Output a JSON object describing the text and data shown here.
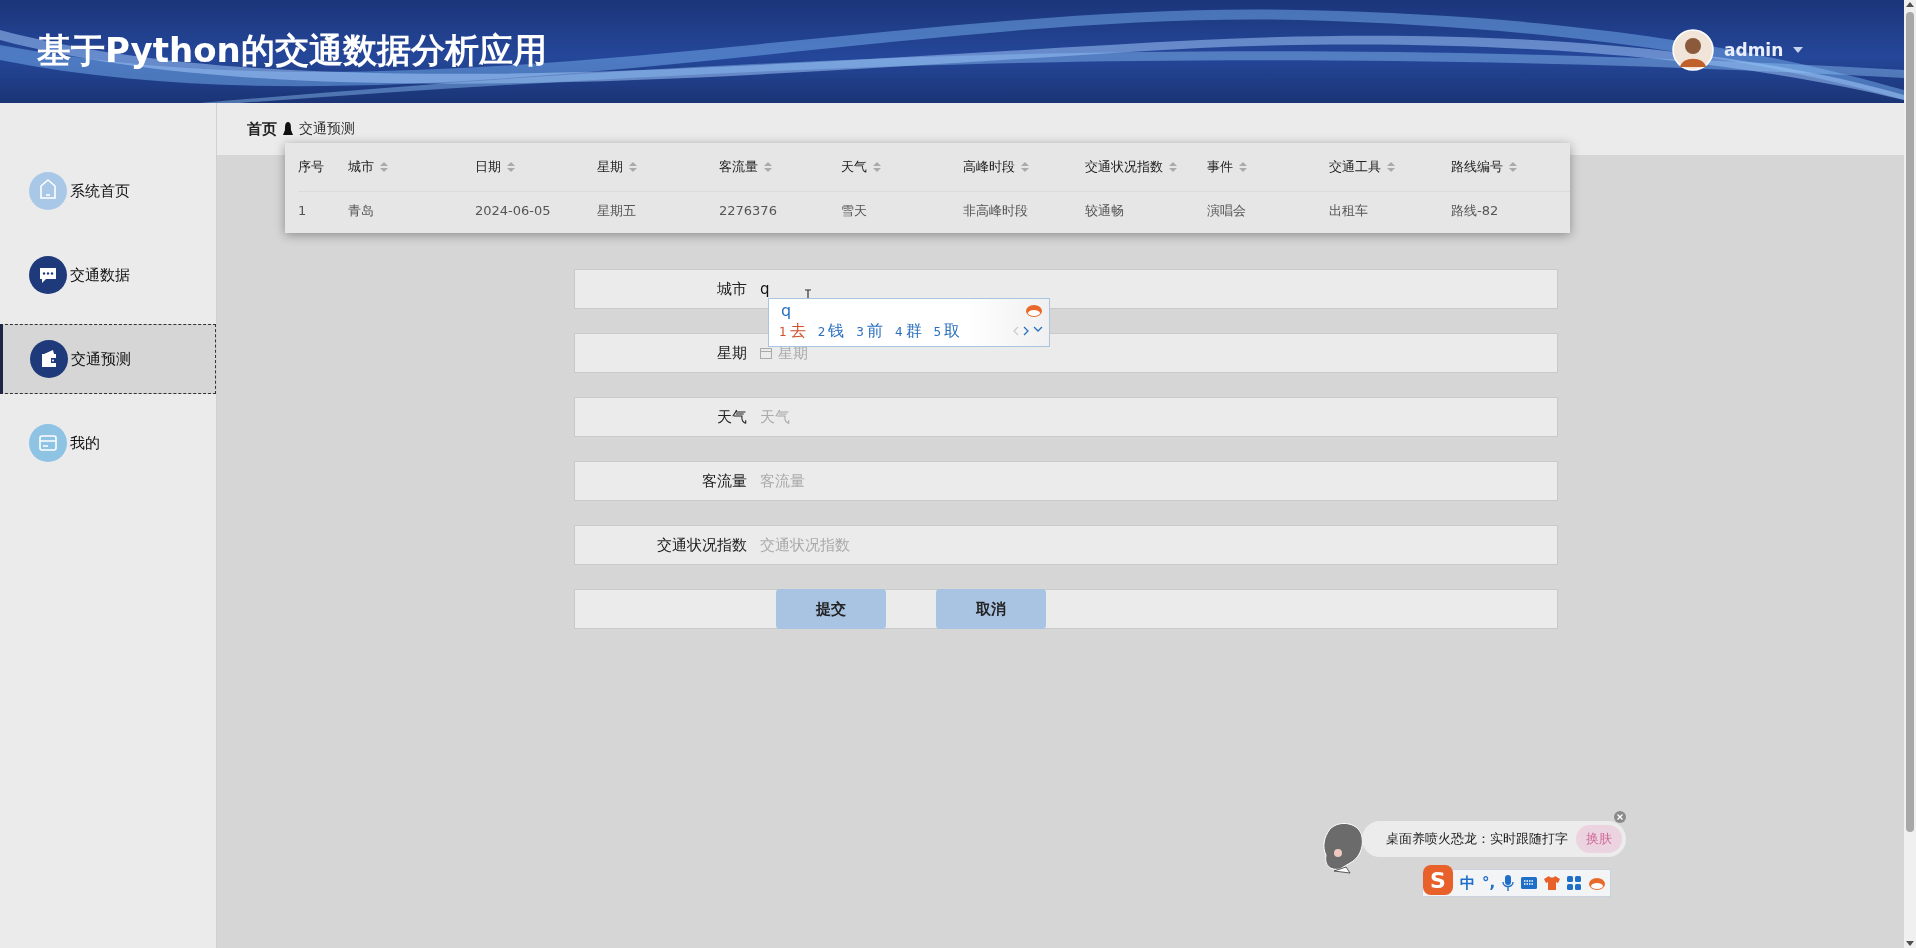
{
  "header": {
    "title": "基于Python的交通数据分析应用",
    "user": "admin"
  },
  "sidebar": {
    "items": [
      {
        "label": "系统首页",
        "kind": "home",
        "color": "#a9c8e8",
        "selected": false
      },
      {
        "label": "交通数据",
        "kind": "chat",
        "color": "#1f3a7a",
        "selected": false
      },
      {
        "label": "交通预测",
        "kind": "wallet",
        "color": "#1f3a7a",
        "selected": true
      },
      {
        "label": "我的",
        "kind": "card",
        "color": "#8ec3e3",
        "selected": false
      }
    ]
  },
  "breadcrumb": [
    "首页",
    "交通预测"
  ],
  "table": {
    "columns": [
      {
        "label": "序号",
        "sortable": false
      },
      {
        "label": "城市",
        "sortable": true
      },
      {
        "label": "日期",
        "sortable": true
      },
      {
        "label": "星期",
        "sortable": true
      },
      {
        "label": "客流量",
        "sortable": true
      },
      {
        "label": "天气",
        "sortable": true
      },
      {
        "label": "高峰时段",
        "sortable": true
      },
      {
        "label": "交通状况指数",
        "sortable": true
      },
      {
        "label": "事件",
        "sortable": true
      },
      {
        "label": "交通工具",
        "sortable": true
      },
      {
        "label": "路线编号",
        "sortable": true
      }
    ],
    "rows": [
      [
        "1",
        "青岛",
        "2024-06-05",
        "星期五",
        "2276376",
        "雪天",
        "非高峰时段",
        "较通畅",
        "演唱会",
        "出租车",
        "路线-82"
      ]
    ]
  },
  "form": {
    "fields": [
      {
        "label": "城市",
        "value": "q",
        "kind": "text"
      },
      {
        "label": "星期",
        "placeholder": "星期",
        "kind": "date"
      },
      {
        "label": "天气",
        "placeholder": "天气",
        "kind": "text"
      },
      {
        "label": "客流量",
        "placeholder": "客流量",
        "kind": "text"
      },
      {
        "label": "交通状况指数",
        "placeholder": "交通状况指数",
        "kind": "text"
      }
    ],
    "buttons": [
      "提交",
      "取消"
    ]
  },
  "ime": {
    "composition": "q",
    "candidates": [
      {
        "index": "1",
        "text": "去",
        "selected": true
      },
      {
        "index": "2",
        "text": "钱",
        "selected": false
      },
      {
        "index": "3",
        "text": "前",
        "selected": false
      },
      {
        "index": "4",
        "text": "群",
        "selected": false
      },
      {
        "index": "5",
        "text": "取",
        "selected": false
      }
    ]
  },
  "widget": {
    "text": "桌面养喷火恐龙：实时跟随打字",
    "button": "换肤"
  },
  "ime_toolbar": {
    "logo": "S",
    "items": [
      "中",
      "°,"
    ]
  }
}
